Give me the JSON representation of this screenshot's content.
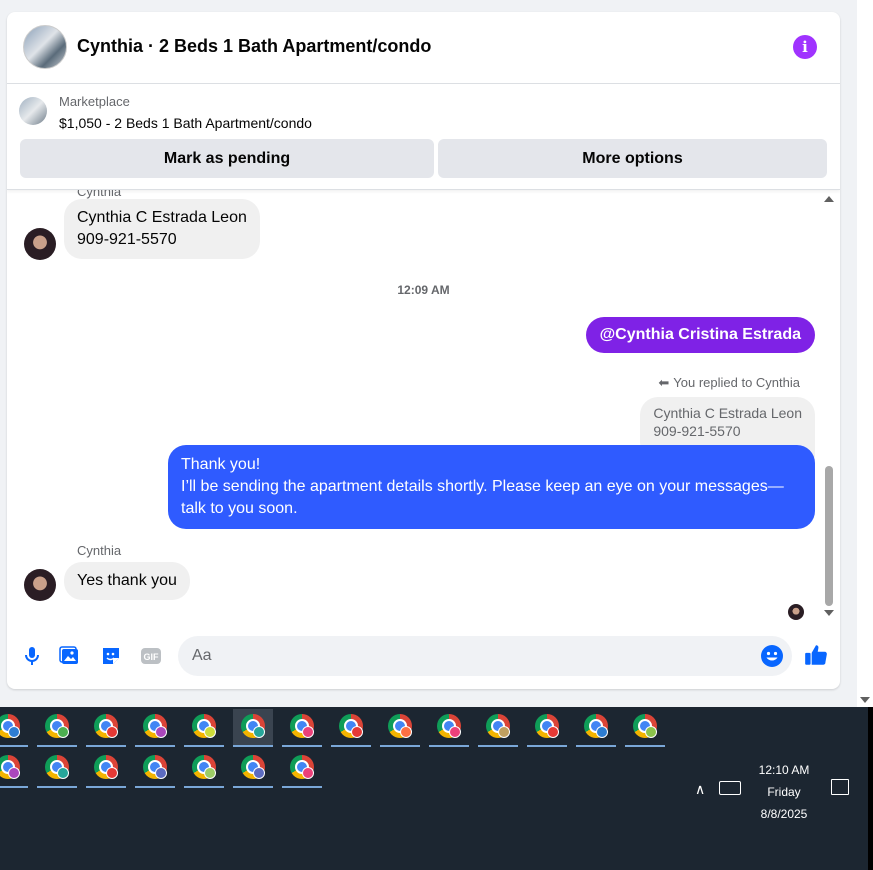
{
  "header": {
    "title": "Cynthia · 2 Beds 1 Bath Apartment/condo",
    "info_icon": "info-icon",
    "accent": "#a033ff"
  },
  "listing": {
    "kind": "Marketplace",
    "price_title": "$1,050 - 2 Beds 1 Bath Apartment/condo",
    "btn_pending": "Mark as pending",
    "btn_more": "More options"
  },
  "messages": {
    "partial_sender": "Cynthia",
    "contact_card": "Cynthia C Estrada Leon\n909-921-5570",
    "timestamp": "12:09 AM",
    "mention": "@Cynthia Cristina Estrada",
    "replied_label": "You replied to Cynthia",
    "quoted": "Cynthia C Estrada Leon\n909-921-5570",
    "outgoing": "Thank you!\nI’ll be sending the apartment details shortly. Please keep an eye on your messages—talk to you soon.",
    "sender2": "Cynthia",
    "reply": "Yes thank you",
    "outgoing_color": "#2f5bff",
    "mention_color": "#7f22e6"
  },
  "composer": {
    "placeholder": "Aa",
    "icons": [
      "microphone-icon",
      "image-icon",
      "sticker-icon",
      "gif-icon",
      "emoji-icon",
      "thumbs-up-icon"
    ],
    "gif_label": "GIF",
    "accent": "#0866ff"
  },
  "taskbar": {
    "clock_time": "12:10 AM",
    "clock_day": "Friday",
    "clock_date": "8/8/2025",
    "row1_profile_colors": [
      "#2d7dd2",
      "#4caf50",
      "#e53935",
      "#ab47bc",
      "#cddc39",
      "#26a69a",
      "#ec407a",
      "#e53935",
      "#ff7043",
      "#ec407a",
      "#c0a060",
      "#e53935",
      "#2d7dd2",
      "#8bc34a"
    ],
    "row2_profile_colors": [
      "#ab47bc",
      "#26a69a",
      "#e53935",
      "#5c6bc0",
      "#9ccc65",
      "#5c6bc0",
      "#ec407a"
    ]
  }
}
